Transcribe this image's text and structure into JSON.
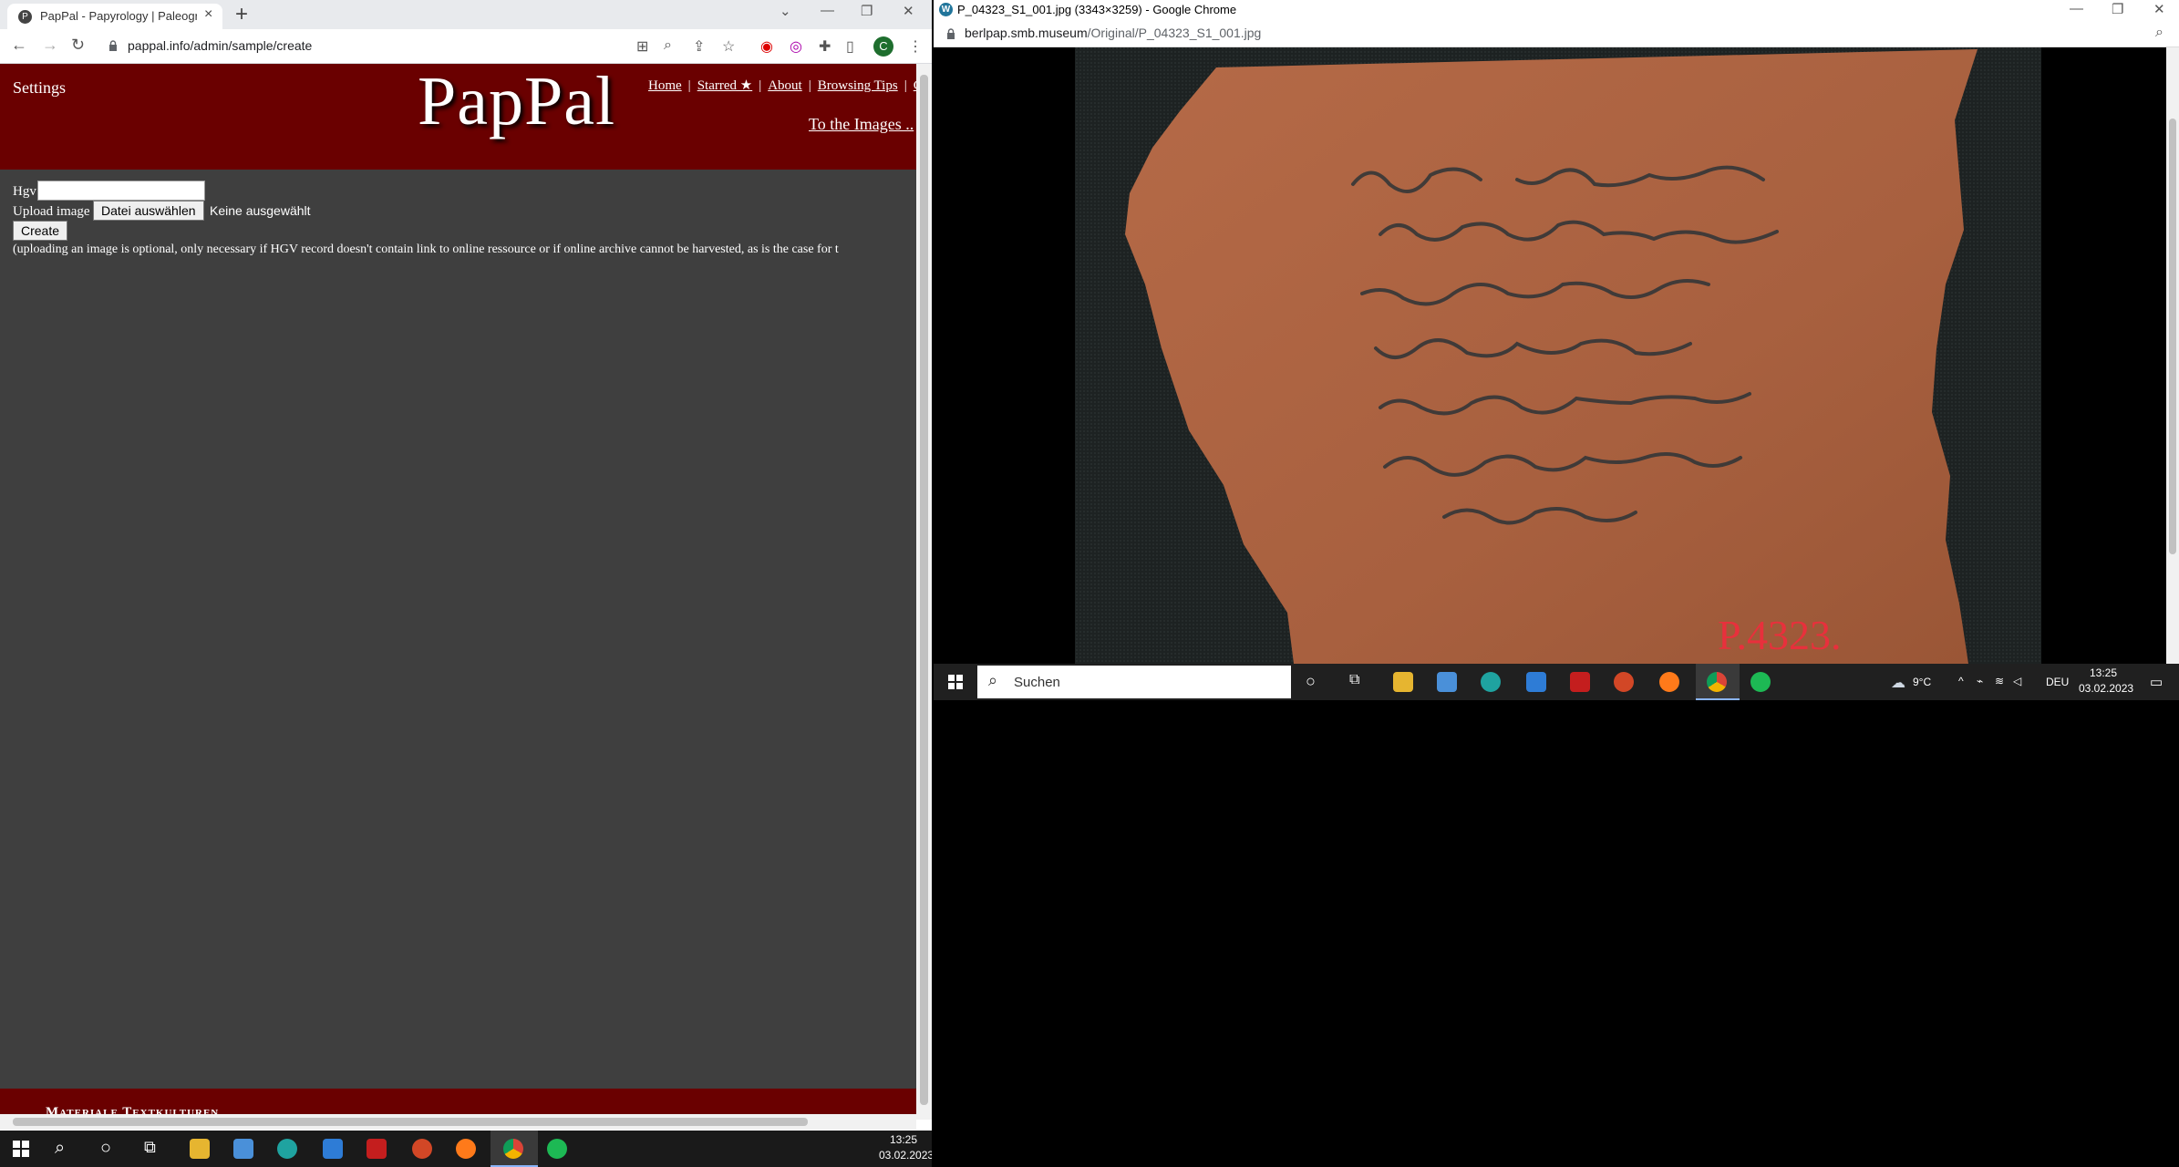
{
  "left_browser": {
    "tab_title": "PapPal - Papyrology | Paleograph",
    "tab_favicon": "P",
    "new_tab": "+",
    "url": "pappal.info/admin/sample/create",
    "avatar_letter": "C",
    "site": {
      "settings": "Settings",
      "logo": "PapPal",
      "nav": [
        "Home",
        "Starred ★",
        "About",
        "Browsing Tips",
        "C"
      ],
      "images_link": "To the Images ..",
      "footer": "Materiale Textkulturen"
    },
    "form": {
      "hgv_label": "Hgv",
      "hgv_value": "",
      "upload_label": "Upload image",
      "file_button": "Datei auswählen",
      "file_status": "Keine ausgewählt",
      "create_button": "Create",
      "note": "(uploading an image is optional, only necessary if HGV record doesn't contain link to online ressource or if online archive cannot be harvested, as is the case for t"
    },
    "taskbar": {
      "time": "13:25",
      "date": "03.02.2023"
    }
  },
  "right_browser": {
    "title": "P_04323_S1_001.jpg (3343×3259) - Google Chrome",
    "url_host": "berlpap.smb.museum",
    "url_path": "/Original/P_04323_S1_001.jpg",
    "inventory_mark": "P.4323.",
    "taskbar": {
      "search_text": "Suchen",
      "weather": "9°C",
      "lang": "DEU",
      "time": "13:25",
      "date": "03.02.2023"
    }
  },
  "colors": {
    "site_header": "#6a0000",
    "page_bg": "#3f3f3f",
    "sherd": "#a8603f",
    "ink": "#2e3437",
    "red_mark": "#e8303c",
    "chrome_green": "#1e6e2e",
    "spotify_green": "#1db954"
  }
}
